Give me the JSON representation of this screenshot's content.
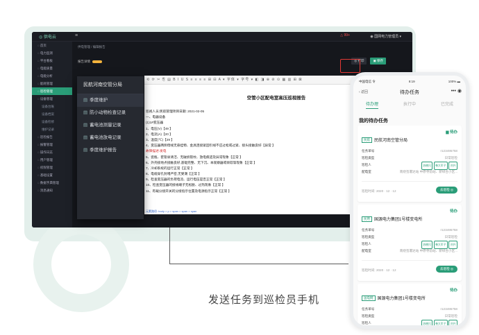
{
  "caption": "发送任务到巡检员手机",
  "colors": {
    "accent": "#2a9d78",
    "highlight": "#e53935",
    "panel_bg": "#e3efeb"
  },
  "desktop": {
    "logo": "◎ 供电云",
    "menu_icon": "≡",
    "badge": "△ 99+",
    "user": "◉ 国网电力管理员 ▾",
    "breadcrumb": "供电管理 / 编辑报告",
    "tab": "报告详情",
    "buttons": [
      {
        "label": "◎ 打印"
      },
      {
        "label": "▣ 保存"
      }
    ],
    "sidebar": [
      {
        "label": "◌ 首页"
      },
      {
        "label": "◌ 电力监测"
      },
      {
        "label": "◌ 平台看板"
      },
      {
        "label": "◌ 电能质量"
      },
      {
        "label": "◌ 电能分析"
      },
      {
        "label": "◌ 能耗管理"
      },
      {
        "label": "◌ 巡检管理"
      },
      {
        "label": "◌ 设备管理"
      },
      {
        "label": "设备台账"
      },
      {
        "label": "设备档案"
      },
      {
        "label": "设备检修"
      },
      {
        "label": "维护记录"
      },
      {
        "label": "◌ 巡检报告"
      },
      {
        "label": "◌ 报警管理"
      },
      {
        "label": "◌ 操作日志"
      },
      {
        "label": "◌ 用户管理"
      },
      {
        "label": "◌ 权限管理"
      },
      {
        "label": "◌ 基础设置"
      },
      {
        "label": "◌ 数据字典管理"
      },
      {
        "label": "◌ 消息通知"
      }
    ]
  },
  "menu": {
    "title": "民航河南空管分局",
    "items": [
      {
        "label": "季度维护"
      },
      {
        "label": "防小动物检查记录"
      },
      {
        "label": "蓄电池测量记录"
      },
      {
        "label": "蓄电池放电记录"
      },
      {
        "label": "季度维护报告"
      }
    ]
  },
  "doc": {
    "toolbar": "⟲ ⟳ ✂ ⎘ ▤ B I U S ≡ ≡ ≡ ≡ ⊞ ⊟ A ▾ 字体 ▾ 字号 ▾ ◧ ◨ ⊕ ⊘ ⊙ ▦ ▥ ⊞ ⊠",
    "title": "空管小区配电室高压巡视报告",
    "lines": [
      "巡视人员:民航管理项目日期: 2021-02-05",
      "一、电器设备",
      "(1)1#变压器",
      "1、电压(V)【49 】",
      "2、电流(A)【20 】",
      "3、温度(℃)【29 】",
      "4、变压器两侧母线无悬挂物、金具连接紧固引线不应过松或过紧、接头接触良好【异常 】",
      "故障描述:发电",
      "5、瓷瓶、套管县清洁、无破损裂纹、放电痕迹及异常现象【正常 】",
      "6、外壳接地点接触良好,基础完整、无下沉、本观察器或倾软等现象【正常 】",
      "7、冷却系统的运行正常【正常 】",
      "8、电缆穿孔封堵严密,无受潮【正常 】",
      "9、检查变压器的负荷电流、运行电压是否正常【正常 】",
      "10、检查变压器的接线端子无松脱、过热现象【正常 】",
      "11、有载分接开关的分接指示位置及电源指示正常【正常 】"
    ],
    "footer": "元素路径: body > p > span > span > span"
  },
  "phone": {
    "status_left": "中国电信 令",
    "status_time": "8:19",
    "status_right": "100% ▬",
    "back": "‹ 返回",
    "title": "待办任务",
    "more": "•••  ◉",
    "tabs": [
      {
        "label": "待办理"
      },
      {
        "label": "执行中"
      },
      {
        "label": "已完成"
      }
    ],
    "section": "我的待办任务",
    "labels": {
      "task_no": "任务单号",
      "task_type": "巡检类型",
      "inspector": "巡检人",
      "room": "配电室",
      "time_label": "巡检时间:"
    },
    "cards": [
      {
        "tag": "民航",
        "name": "民航河南空管分局",
        "status": "待办",
        "task_no": "r123495758",
        "type": "日常巡检",
        "inspectors": [
          "苏晓闪",
          "韩大军子",
          "刘兴"
        ],
        "room": "南绕签署达站 中原寺前站、新绿台小区...",
        "time": "2020 · 12 · 12",
        "btn": "去巡检 ◎"
      },
      {
        "tag": "民用",
        "name": "国源电力集团1号楼变电所",
        "status": "待办",
        "task_no": "r123495758",
        "type": "日常巡检",
        "inspectors": [
          "苏晓闪",
          "韩大军子",
          "刘兴"
        ],
        "room": "南绕签署达站 中原寺前站、新绿台小区...",
        "time": "2020 · 12 · 12",
        "btn": "去巡检 ◎"
      },
      {
        "tag": "国电网",
        "name": "国源电力集团1号楼变电所",
        "status": "待办",
        "task_no": "r123495758",
        "type": "日常巡检",
        "inspectors": [
          "苏晓闪",
          "韩大军子",
          "刘兴"
        ]
      }
    ]
  }
}
